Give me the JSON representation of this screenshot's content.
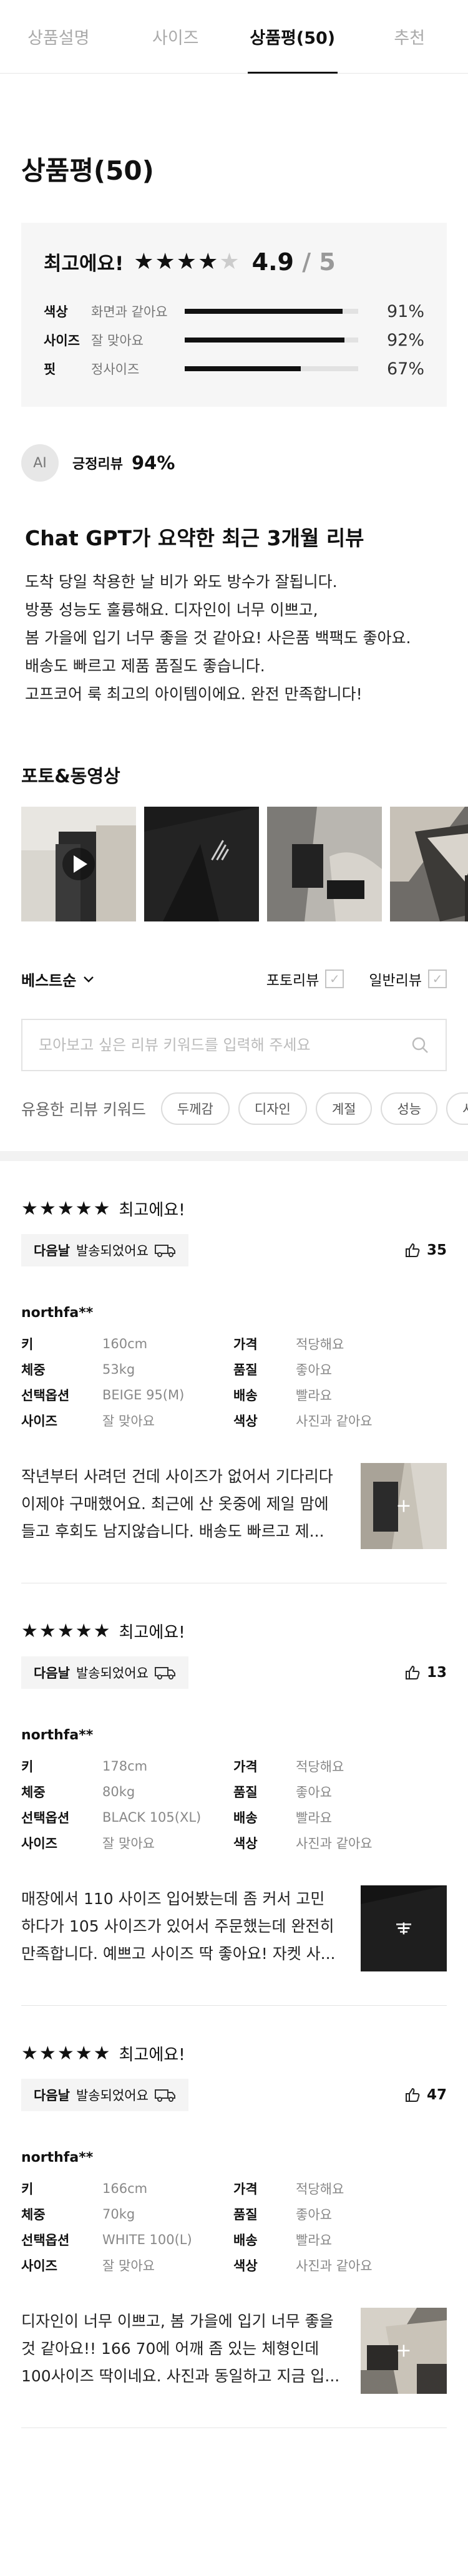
{
  "tabs": [
    "상품설명",
    "사이즈",
    "상품평(50)",
    "추천"
  ],
  "active_tab": 2,
  "section_title": "상품평(50)",
  "summary": {
    "label": "최고에요!",
    "stars": 4,
    "score": "4.9",
    "max": "/ 5",
    "rows": [
      {
        "key": "색상",
        "value": "화면과 같아요",
        "pct": "91%",
        "fraction": 0.91
      },
      {
        "key": "사이즈",
        "value": "잘 맞아요",
        "pct": "92%",
        "fraction": 0.92
      },
      {
        "key": "핏",
        "value": "정사이즈",
        "pct": "67%",
        "fraction": 0.67
      }
    ]
  },
  "ai": {
    "badge": "AI",
    "label": "긍정리뷰",
    "pct": "94%",
    "title": "Chat GPT가 요약한 최근 3개월 리뷰",
    "lines": [
      "도착 당일 착용한 날 비가 와도 방수가 잘됩니다.",
      "방풍 성능도 훌륭해요. 디자인이 너무 이쁘고,",
      "봄 가을에 입기 너무 좋을 것 같아요! 사은품 백팩도 좋아요.",
      "배송도 빠르고 제품 품질도 좋습니다.",
      "고프코어 룩 최고의 아이템이에요. 완전 만족합니다!"
    ]
  },
  "photos": {
    "title": "포토&동영상",
    "items": [
      "video-thumb",
      "black-jacket-logo",
      "jacket-sleeve",
      "jacket-detail"
    ]
  },
  "filter": {
    "sort": "베스트순",
    "photo_review": "포토리뷰",
    "general_review": "일반리뷰"
  },
  "search": {
    "placeholder": "모아보고 싶은 리뷰 키워드를 입력해 주세요"
  },
  "keywords": {
    "label": "유용한 리뷰 키워드",
    "chips": [
      "두께감",
      "디자인",
      "계절",
      "성능",
      "사이즈"
    ]
  },
  "reviews": [
    {
      "stars": 5,
      "grade": "최고에요!",
      "ship_bold": "다음날",
      "ship_text": "발송되었어요",
      "likes": "35",
      "author": "northfa**",
      "meta": [
        [
          "키",
          "160cm",
          "가격",
          "적당해요"
        ],
        [
          "체중",
          "53kg",
          "품질",
          "좋아요"
        ],
        [
          "선택옵션",
          "BEIGE 95(M)",
          "배송",
          "빨라요"
        ],
        [
          "사이즈",
          "잘 맞아요",
          "색상",
          "사진과 같아요"
        ]
      ],
      "text_lines": [
        "작년부터 사려던 건데 사이즈가 없어서 기다리다",
        "이제야 구매했어요. 최근에 산 옷중에 제일 맘에",
        "들고 후회도 남지않습니다. 배송도 빠르고 제..."
      ],
      "thumb": "beige"
    },
    {
      "stars": 5,
      "grade": "최고에요!",
      "ship_bold": "다음날",
      "ship_text": "발송되었어요",
      "likes": "13",
      "author": "northfa**",
      "meta": [
        [
          "키",
          "178cm",
          "가격",
          "적당해요"
        ],
        [
          "체중",
          "80kg",
          "품질",
          "좋아요"
        ],
        [
          "선택옵션",
          "BLACK 105(XL)",
          "배송",
          "빨라요"
        ],
        [
          "사이즈",
          "잘 맞아요",
          "색상",
          "사진과 같아요"
        ]
      ],
      "text_lines": [
        "매장에서 110 사이즈 입어봤는데 좀 커서 고민",
        "하다가 105 사이즈가 있어서 주문했는데 완전히",
        "만족합니다. 예쁘고 사이즈 딱 좋아요! 자켓 사..."
      ],
      "thumb": "black"
    },
    {
      "stars": 5,
      "grade": "최고에요!",
      "ship_bold": "다음날",
      "ship_text": "발송되었어요",
      "likes": "47",
      "author": "northfa**",
      "meta": [
        [
          "키",
          "166cm",
          "가격",
          "적당해요"
        ],
        [
          "체중",
          "70kg",
          "품질",
          "좋아요"
        ],
        [
          "선택옵션",
          "WHITE 100(L)",
          "배송",
          "빨라요"
        ],
        [
          "사이즈",
          "잘 맞아요",
          "색상",
          "사진과 같아요"
        ]
      ],
      "text_lines": [
        "디자인이 너무 이쁘고, 봄 가을에 입기 너무 좋을",
        "것 같아요!! 166 70에 어깨 좀 있는 체형인데",
        "100사이즈 딱이네요. 사진과 동일하고 지금 입..."
      ],
      "thumb": "white"
    }
  ]
}
